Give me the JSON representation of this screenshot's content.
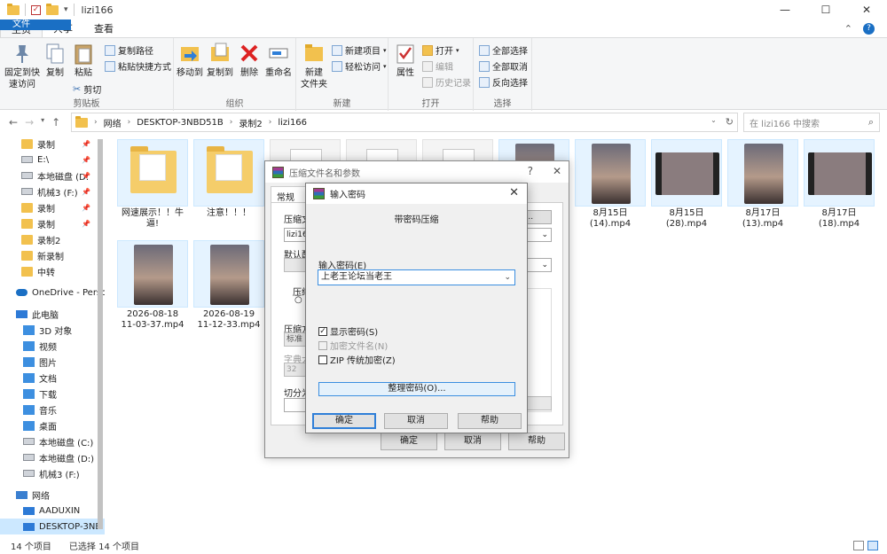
{
  "window": {
    "title": "lizi166",
    "min": "—",
    "max": "☐",
    "close": "✕"
  },
  "ribbon_tabs": [
    "文件",
    "主页",
    "共享",
    "查看"
  ],
  "ribbon": {
    "clipboard": {
      "pin": "固定到快\n速访问",
      "copy": "复制",
      "paste": "粘贴",
      "copy_path": "复制路径",
      "paste_shortcut": "粘贴快捷方式",
      "cut": "剪切",
      "label": "剪贴板"
    },
    "organize": {
      "move_to": "移动到",
      "copy_to": "复制到",
      "delete": "删除",
      "rename": "重命名",
      "label": "组织"
    },
    "new": {
      "new_folder": "新建\n文件夹",
      "new_item": "新建项目",
      "easy_access": "轻松访问",
      "label": "新建"
    },
    "open": {
      "properties": "属性",
      "open": "打开",
      "edit": "编辑",
      "history": "历史记录",
      "label": "打开"
    },
    "select": {
      "select_all": "全部选择",
      "select_none": "全部取消",
      "invert": "反向选择",
      "label": "选择"
    }
  },
  "address": {
    "crumbs": [
      "网络",
      "DESKTOP-3NBD51B",
      "录制2",
      "lizi166"
    ],
    "search_placeholder": "在 lizi166 中搜索"
  },
  "nav_items": [
    {
      "label": "录制",
      "icon": "folder",
      "pinned": true
    },
    {
      "label": "E:\\",
      "icon": "drive",
      "pinned": true
    },
    {
      "label": "本地磁盘 (D:",
      "icon": "drive",
      "pinned": true
    },
    {
      "label": "机械3 (F:)",
      "icon": "drive",
      "pinned": true
    },
    {
      "label": "录制",
      "icon": "folder",
      "pinned": true
    },
    {
      "label": "录制",
      "icon": "folder",
      "pinned": true
    },
    {
      "label": "录制2",
      "icon": "folder",
      "pinned": false
    },
    {
      "label": "新录制",
      "icon": "folder",
      "pinned": false
    },
    {
      "label": "中转",
      "icon": "folder",
      "pinned": false
    },
    {
      "label": "OneDrive - Perso",
      "icon": "cloud",
      "pinned": false
    },
    {
      "label": "此电脑",
      "icon": "pc",
      "pinned": false
    },
    {
      "label": "3D 对象",
      "icon": "blue",
      "pinned": false
    },
    {
      "label": "视频",
      "icon": "blue",
      "pinned": false
    },
    {
      "label": "图片",
      "icon": "blue",
      "pinned": false
    },
    {
      "label": "文档",
      "icon": "blue",
      "pinned": false
    },
    {
      "label": "下载",
      "icon": "blue",
      "pinned": false
    },
    {
      "label": "音乐",
      "icon": "blue",
      "pinned": false
    },
    {
      "label": "桌面",
      "icon": "blue",
      "pinned": false
    },
    {
      "label": "本地磁盘 (C:)",
      "icon": "drive",
      "pinned": false
    },
    {
      "label": "本地磁盘 (D:)",
      "icon": "drive",
      "pinned": false
    },
    {
      "label": "机械3 (F:)",
      "icon": "drive",
      "pinned": false
    },
    {
      "label": "网络",
      "icon": "net",
      "pinned": false
    },
    {
      "label": "AADUXIN",
      "icon": "pc",
      "pinned": false
    },
    {
      "label": "DESKTOP-3NB",
      "icon": "pc",
      "pinned": false
    }
  ],
  "files": [
    {
      "name": "网速展示！！牛\n逼!",
      "kind": "folder"
    },
    {
      "name": "注意！！！",
      "kind": "folder"
    },
    {
      "name": "",
      "kind": "doc"
    },
    {
      "name": "",
      "kind": "doc"
    },
    {
      "name": "",
      "kind": "doc"
    },
    {
      "name": "",
      "kind": "video"
    },
    {
      "name": "8月15日\n(14).mp4",
      "kind": "video"
    },
    {
      "name": "8月15日\n(28).mp4",
      "kind": "video-wide"
    },
    {
      "name": "8月17日\n(13).mp4",
      "kind": "video"
    },
    {
      "name": "8月17日\n(18).mp4",
      "kind": "video-wide"
    },
    {
      "name": "2026-08-18\n11-03-37.mp4",
      "kind": "video"
    },
    {
      "name": "2026-08-19\n11-12-33.mp4",
      "kind": "video"
    }
  ],
  "status": {
    "count": "14 个项目",
    "selected": "已选择 14 个项目"
  },
  "archive_dialog": {
    "title": "压缩文件名和参数",
    "help": "?",
    "close": "✕",
    "tab": "常规",
    "archive_name_label": "压缩文",
    "archive_name_value": "lizi166.",
    "browse": "B)...",
    "default_label": "默认配",
    "format_label": "压缩",
    "method_label": "压缩方",
    "method_value": "标准",
    "dict_label": "字典大",
    "dict_value": "32",
    "split_label": "切分为",
    "ok": "确定",
    "cancel": "取消",
    "help_btn": "帮助"
  },
  "password_dialog": {
    "title": "输入密码",
    "close": "✕",
    "heading": "带密码压缩",
    "password_label": "输入密码(E)",
    "password_value": "上老王论坛当老王",
    "show_password": "显示密码(S)",
    "encrypt_names": "加密文件名(N)",
    "zip_legacy": "ZIP 传统加密(Z)",
    "manage": "整理密码(O)...",
    "ok": "确定",
    "cancel": "取消",
    "help": "帮助"
  }
}
